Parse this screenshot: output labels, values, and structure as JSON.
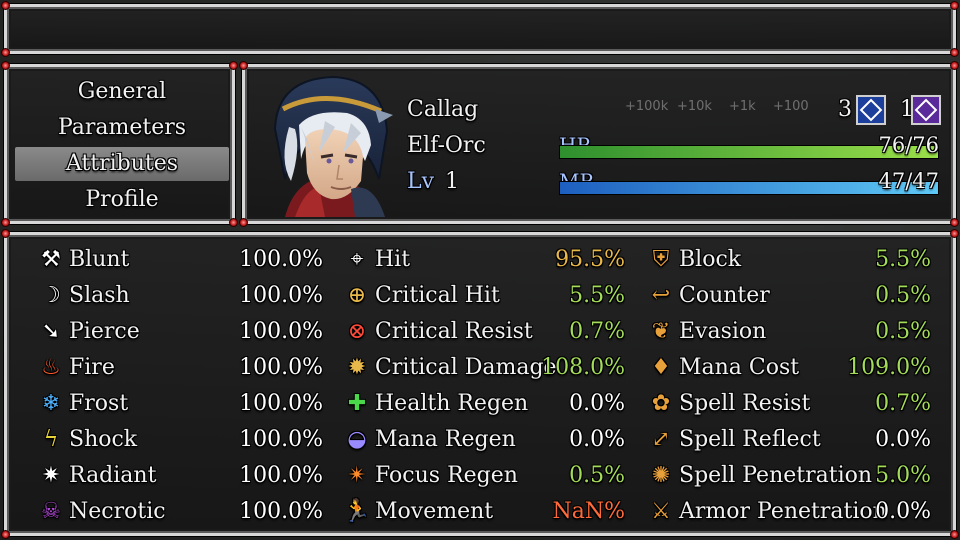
{
  "colors": {
    "normal": "#ffffff",
    "high": "#e8b84a",
    "positive": "#a4dc5a",
    "error": "#ff6a3a",
    "system": "#a8c4ff",
    "hp_gradient": [
      "#2e8f2e",
      "#9be04a"
    ],
    "mp_gradient": [
      "#1d5fbf",
      "#5ec8f5"
    ]
  },
  "menu": {
    "items": [
      {
        "label": "General",
        "selected": false
      },
      {
        "label": "Parameters",
        "selected": false
      },
      {
        "label": "Attributes",
        "selected": true
      },
      {
        "label": "Profile",
        "selected": false
      }
    ]
  },
  "actor": {
    "name": "Callag",
    "race": "Elf-Orc",
    "level_label": "Lv",
    "level": "1",
    "portrait_icon": "knight-portrait",
    "hp": {
      "label": "HP",
      "value": "76/76",
      "ratio": 1.0
    },
    "mp": {
      "label": "MP",
      "value": "47/47",
      "ratio": 1.0
    },
    "skill_points": {
      "count": "3",
      "icon": "sp-badge-icon"
    },
    "job_points": {
      "count": "1",
      "icon": "jp-badge-icon"
    },
    "faint_labels": [
      "+100k",
      "+10k",
      "+1k",
      "+100"
    ]
  },
  "elements": [
    {
      "icon": "blunt-icon",
      "glyph": "⚒",
      "color": "#ffffff",
      "name": "Blunt",
      "value": "100.0%",
      "value_color": "normal"
    },
    {
      "icon": "slash-icon",
      "glyph": "☽",
      "color": "#ffffff",
      "name": "Slash",
      "value": "100.0%",
      "value_color": "normal"
    },
    {
      "icon": "pierce-icon",
      "glyph": "➘",
      "color": "#ffffff",
      "name": "Pierce",
      "value": "100.0%",
      "value_color": "normal"
    },
    {
      "icon": "fire-icon",
      "glyph": "♨",
      "color": "#ff5a2a",
      "name": "Fire",
      "value": "100.0%",
      "value_color": "normal"
    },
    {
      "icon": "frost-icon",
      "glyph": "❄",
      "color": "#4fb2ff",
      "name": "Frost",
      "value": "100.0%",
      "value_color": "normal"
    },
    {
      "icon": "shock-icon",
      "glyph": "ϟ",
      "color": "#e8d43a",
      "name": "Shock",
      "value": "100.0%",
      "value_color": "normal"
    },
    {
      "icon": "radiant-icon",
      "glyph": "✷",
      "color": "#ffffff",
      "name": "Radiant",
      "value": "100.0%",
      "value_color": "normal"
    },
    {
      "icon": "necrotic-icon",
      "glyph": "☠",
      "color": "#b44ad8",
      "name": "Necrotic",
      "value": "100.0%",
      "value_color": "normal"
    }
  ],
  "combat_stats": [
    {
      "icon": "hit-icon",
      "glyph": "⌖",
      "color": "#ffffff",
      "name": "Hit",
      "value": "95.5%",
      "value_color": "high"
    },
    {
      "icon": "critical-hit-icon",
      "glyph": "⊕",
      "color": "#e8b84a",
      "name": "Critical Hit",
      "value": "5.5%",
      "value_color": "positive"
    },
    {
      "icon": "critical-resist-icon",
      "glyph": "⊗",
      "color": "#ff4a3a",
      "name": "Critical Resist",
      "value": "0.7%",
      "value_color": "positive"
    },
    {
      "icon": "critical-damage-icon",
      "glyph": "✹",
      "color": "#e8b84a",
      "name": "Critical Damage",
      "value": "108.0%",
      "value_color": "positive"
    },
    {
      "icon": "health-regen-icon",
      "glyph": "✚",
      "color": "#4ad84a",
      "name": "Health Regen",
      "value": "0.0%",
      "value_color": "normal"
    },
    {
      "icon": "mana-regen-icon",
      "glyph": "◒",
      "color": "#9a8aff",
      "name": "Mana Regen",
      "value": "0.0%",
      "value_color": "normal"
    },
    {
      "icon": "focus-regen-icon",
      "glyph": "✴",
      "color": "#ff8a2a",
      "name": "Focus Regen",
      "value": "0.5%",
      "value_color": "positive"
    },
    {
      "icon": "movement-icon",
      "glyph": "🏃",
      "color": "#ffffff",
      "name": "Movement",
      "value": "NaN%",
      "value_color": "error"
    }
  ],
  "defense_stats": [
    {
      "icon": "block-icon",
      "glyph": "⛨",
      "color": "#e8a03a",
      "name": "Block",
      "value": "5.5%",
      "value_color": "positive"
    },
    {
      "icon": "counter-icon",
      "glyph": "↩",
      "color": "#e8a03a",
      "name": "Counter",
      "value": "0.5%",
      "value_color": "positive"
    },
    {
      "icon": "evasion-icon",
      "glyph": "❦",
      "color": "#e8a03a",
      "name": "Evasion",
      "value": "0.5%",
      "value_color": "positive"
    },
    {
      "icon": "mana-cost-icon",
      "glyph": "♦",
      "color": "#e8a03a",
      "name": "Mana Cost",
      "value": "109.0%",
      "value_color": "positive"
    },
    {
      "icon": "spell-resist-icon",
      "glyph": "✿",
      "color": "#e8a03a",
      "name": "Spell Resist",
      "value": "0.7%",
      "value_color": "positive"
    },
    {
      "icon": "spell-reflect-icon",
      "glyph": "⤢",
      "color": "#e8a03a",
      "name": "Spell Reflect",
      "value": "0.0%",
      "value_color": "normal"
    },
    {
      "icon": "spell-penetration-icon",
      "glyph": "✺",
      "color": "#e8a03a",
      "name": "Spell Penetration",
      "value": "5.0%",
      "value_color": "positive"
    },
    {
      "icon": "armor-penetration-icon",
      "glyph": "⚔",
      "color": "#e8a03a",
      "name": "Armor Penetration",
      "value": "0.0%",
      "value_color": "normal"
    }
  ]
}
